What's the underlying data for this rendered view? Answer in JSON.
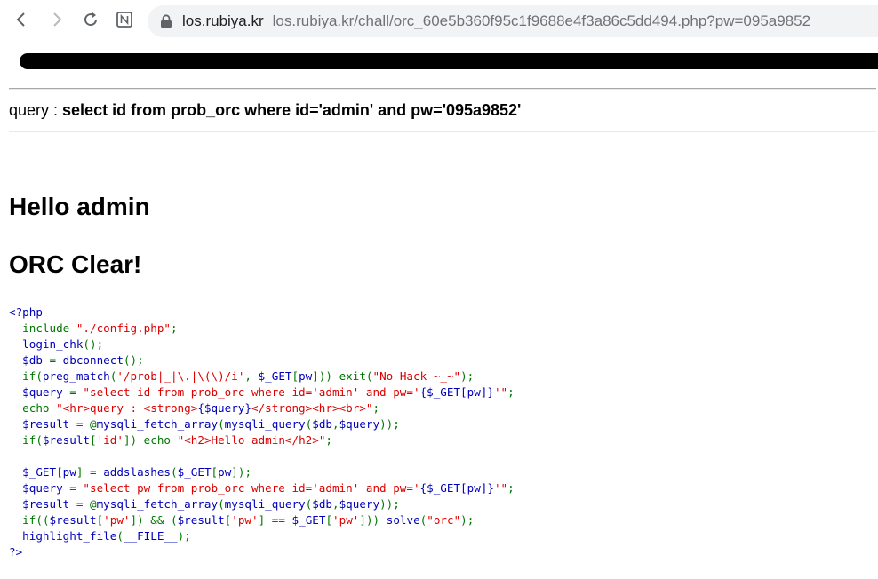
{
  "browser": {
    "url_host": "los.rubiya.kr",
    "url_rest": "los.rubiya.kr/chall/orc_60e5b360f95c1f9688e4f3a86c5dd494.php?pw=095a9852"
  },
  "page": {
    "query_label": "query : ",
    "query_text": "select id from prob_orc where id='admin' and pw='095a9852'",
    "hello_heading": "Hello admin",
    "clear_heading": "ORC Clear!"
  },
  "source_code": [
    [
      {
        "t": "<?php",
        "c": "php"
      }
    ],
    [
      {
        "t": "  include ",
        "c": "kw"
      },
      {
        "t": "\"./config.php\"",
        "c": "str"
      },
      {
        "t": ";",
        "c": "kw"
      }
    ],
    [
      {
        "t": "  login_chk",
        "c": "php"
      },
      {
        "t": "();",
        "c": "kw"
      }
    ],
    [
      {
        "t": "  $db ",
        "c": "php"
      },
      {
        "t": "= ",
        "c": "kw"
      },
      {
        "t": "dbconnect",
        "c": "php"
      },
      {
        "t": "();",
        "c": "kw"
      }
    ],
    [
      {
        "t": "  if(",
        "c": "kw"
      },
      {
        "t": "preg_match",
        "c": "php"
      },
      {
        "t": "(",
        "c": "kw"
      },
      {
        "t": "'/prob|_|\\.|\\(\\)/i'",
        "c": "str"
      },
      {
        "t": ", ",
        "c": "kw"
      },
      {
        "t": "$_GET",
        "c": "php"
      },
      {
        "t": "[",
        "c": "kw"
      },
      {
        "t": "pw",
        "c": "php"
      },
      {
        "t": "])) exit(",
        "c": "kw"
      },
      {
        "t": "\"No Hack ~_~\"",
        "c": "str"
      },
      {
        "t": ");",
        "c": "kw"
      }
    ],
    [
      {
        "t": "  $query ",
        "c": "php"
      },
      {
        "t": "= ",
        "c": "kw"
      },
      {
        "t": "\"select id from prob_orc where id='admin' and pw='",
        "c": "str"
      },
      {
        "t": "{$_GET[pw]}",
        "c": "php"
      },
      {
        "t": "'\"",
        "c": "str"
      },
      {
        "t": ";",
        "c": "kw"
      }
    ],
    [
      {
        "t": "  echo ",
        "c": "kw"
      },
      {
        "t": "\"<hr>query : <strong>",
        "c": "str"
      },
      {
        "t": "{$query}",
        "c": "php"
      },
      {
        "t": "</strong><hr><br>\"",
        "c": "str"
      },
      {
        "t": ";",
        "c": "kw"
      }
    ],
    [
      {
        "t": "  $result ",
        "c": "php"
      },
      {
        "t": "= @",
        "c": "kw"
      },
      {
        "t": "mysqli_fetch_array",
        "c": "php"
      },
      {
        "t": "(",
        "c": "kw"
      },
      {
        "t": "mysqli_query",
        "c": "php"
      },
      {
        "t": "(",
        "c": "kw"
      },
      {
        "t": "$db",
        "c": "php"
      },
      {
        "t": ",",
        "c": "kw"
      },
      {
        "t": "$query",
        "c": "php"
      },
      {
        "t": "));",
        "c": "kw"
      }
    ],
    [
      {
        "t": "  if(",
        "c": "kw"
      },
      {
        "t": "$result",
        "c": "php"
      },
      {
        "t": "[",
        "c": "kw"
      },
      {
        "t": "'id'",
        "c": "str"
      },
      {
        "t": "]) echo ",
        "c": "kw"
      },
      {
        "t": "\"<h2>Hello admin</h2>\"",
        "c": "str"
      },
      {
        "t": ";",
        "c": "kw"
      }
    ],
    [
      {
        "t": " ",
        "c": "php"
      }
    ],
    [
      {
        "t": "  $_GET",
        "c": "php"
      },
      {
        "t": "[",
        "c": "kw"
      },
      {
        "t": "pw",
        "c": "php"
      },
      {
        "t": "] = ",
        "c": "kw"
      },
      {
        "t": "addslashes",
        "c": "php"
      },
      {
        "t": "(",
        "c": "kw"
      },
      {
        "t": "$_GET",
        "c": "php"
      },
      {
        "t": "[",
        "c": "kw"
      },
      {
        "t": "pw",
        "c": "php"
      },
      {
        "t": "]);",
        "c": "kw"
      }
    ],
    [
      {
        "t": "  $query ",
        "c": "php"
      },
      {
        "t": "= ",
        "c": "kw"
      },
      {
        "t": "\"select pw from prob_orc where id='admin' and pw='",
        "c": "str"
      },
      {
        "t": "{$_GET[pw]}",
        "c": "php"
      },
      {
        "t": "'\"",
        "c": "str"
      },
      {
        "t": ";",
        "c": "kw"
      }
    ],
    [
      {
        "t": "  $result ",
        "c": "php"
      },
      {
        "t": "= @",
        "c": "kw"
      },
      {
        "t": "mysqli_fetch_array",
        "c": "php"
      },
      {
        "t": "(",
        "c": "kw"
      },
      {
        "t": "mysqli_query",
        "c": "php"
      },
      {
        "t": "(",
        "c": "kw"
      },
      {
        "t": "$db",
        "c": "php"
      },
      {
        "t": ",",
        "c": "kw"
      },
      {
        "t": "$query",
        "c": "php"
      },
      {
        "t": "));",
        "c": "kw"
      }
    ],
    [
      {
        "t": "  if((",
        "c": "kw"
      },
      {
        "t": "$result",
        "c": "php"
      },
      {
        "t": "[",
        "c": "kw"
      },
      {
        "t": "'pw'",
        "c": "str"
      },
      {
        "t": "]) && (",
        "c": "kw"
      },
      {
        "t": "$result",
        "c": "php"
      },
      {
        "t": "[",
        "c": "kw"
      },
      {
        "t": "'pw'",
        "c": "str"
      },
      {
        "t": "] == ",
        "c": "kw"
      },
      {
        "t": "$_GET",
        "c": "php"
      },
      {
        "t": "[",
        "c": "kw"
      },
      {
        "t": "'pw'",
        "c": "str"
      },
      {
        "t": "])) ",
        "c": "kw"
      },
      {
        "t": "solve",
        "c": "php"
      },
      {
        "t": "(",
        "c": "kw"
      },
      {
        "t": "\"orc\"",
        "c": "str"
      },
      {
        "t": ");",
        "c": "kw"
      }
    ],
    [
      {
        "t": "  highlight_file",
        "c": "php"
      },
      {
        "t": "(",
        "c": "kw"
      },
      {
        "t": "__FILE__",
        "c": "php"
      },
      {
        "t": ");",
        "c": "kw"
      }
    ],
    [
      {
        "t": "?>",
        "c": "php"
      }
    ]
  ]
}
